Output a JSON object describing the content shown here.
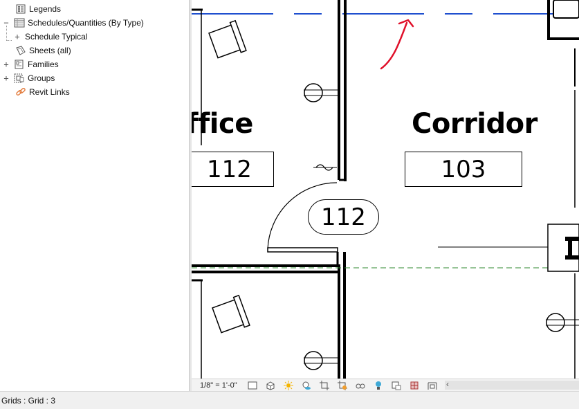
{
  "project_browser": {
    "items": [
      {
        "label": "Legends",
        "expander": "",
        "icon": "legend-icon"
      },
      {
        "label": "Schedules/Quantities (By Type)",
        "expander": "−",
        "icon": "schedule-icon"
      },
      {
        "label": "Schedule Typical",
        "expander": "+",
        "icon": ""
      },
      {
        "label": "Sheets (all)",
        "expander": "",
        "icon": "sheets-icon"
      },
      {
        "label": "Families",
        "expander": "+",
        "icon": "families-icon"
      },
      {
        "label": "Groups",
        "expander": "+",
        "icon": "groups-icon"
      },
      {
        "label": "Revit Links",
        "expander": "",
        "icon": "revit-links-icon"
      }
    ]
  },
  "canvas": {
    "rooms": [
      {
        "name": "ffice",
        "number": "112"
      },
      {
        "name": "Corridor",
        "number": "103"
      }
    ],
    "door_tag": "112"
  },
  "view_controls": {
    "scale": "1/8\" = 1'-0\"",
    "icons": [
      "detail-level-icon",
      "visual-style-icon",
      "sun-path-icon",
      "shadows-icon",
      "crop-view-icon",
      "show-crop-icon",
      "temporary-hide-icon",
      "reveal-hidden-icon",
      "lock-3d-icon",
      "analytical-model-icon",
      "highlight-displacement-icon",
      "worksharing-icon"
    ]
  },
  "status": {
    "text": "Grids : Grid : 3"
  },
  "colors": {
    "grid_line": "#1f4fcf",
    "annotation": "#e0102a",
    "level_line": "#2f8a2f"
  }
}
